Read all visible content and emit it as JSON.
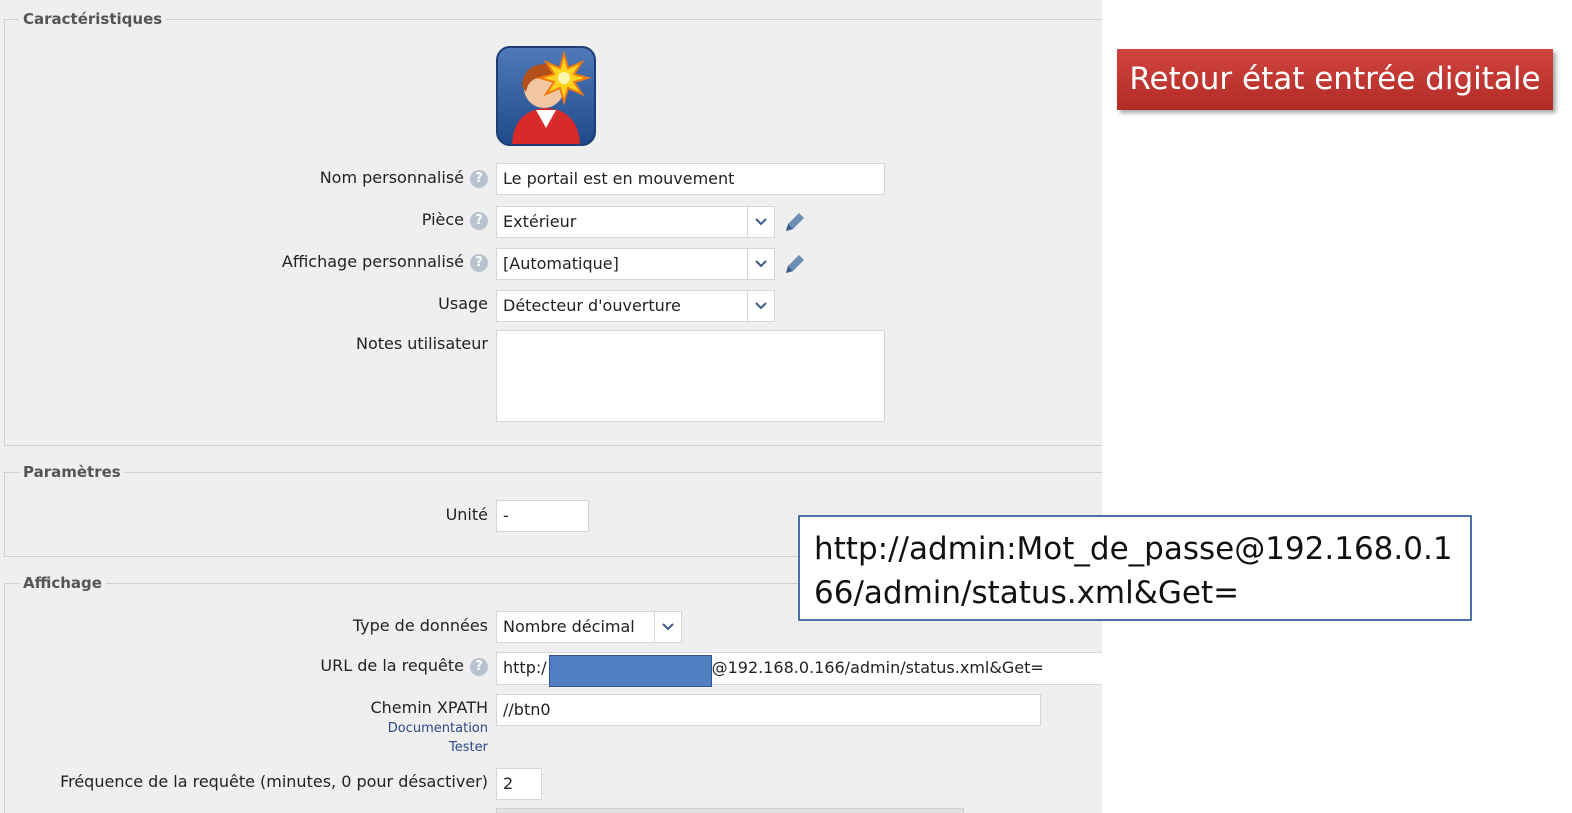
{
  "sections": {
    "caracteristiques": "Caractéristiques",
    "parametres": "Paramètres",
    "affichage": "Affichage"
  },
  "caracteristiques": {
    "nom_label": "Nom personnalisé",
    "nom_value": "Le portail est en mouvement",
    "piece_label": "Pièce",
    "piece_value": "Extérieur",
    "affichage_label": "Affichage personnalisé",
    "affichage_value": "[Automatique]",
    "usage_label": "Usage",
    "usage_value": "Détecteur d'ouverture",
    "notes_label": "Notes utilisateur",
    "notes_value": ""
  },
  "parametres": {
    "unite_label": "Unité",
    "unite_value": "-"
  },
  "affichage": {
    "type_label": "Type de données",
    "type_value": "Nombre décimal",
    "url_label": "URL de la requête",
    "url_prefix": "http:/",
    "url_suffix": "@192.168.0.166/admin/status.xml&Get=",
    "xpath_label": "Chemin XPATH",
    "xpath_value": "//btn0",
    "documentation_link": "Documentation",
    "tester_link": "Tester",
    "freq_label": "Fréquence de la requête (minutes, 0 pour désactiver)",
    "freq_value": "2"
  },
  "annotation": {
    "title_badge": "Retour état entrée digitale",
    "callout_text": "http://admin:Mot_de_passe@192.168.0.166/admin/status.xml&Get="
  },
  "icons": {
    "help": "help-icon",
    "chevron": "chevron-down-icon",
    "pencil": "pencil-icon",
    "avatar": "user-alert-avatar-icon"
  },
  "colors": {
    "badge_red": "#c0342f",
    "callout_border": "#4a72a8",
    "redaction_blue": "#4f7fc1"
  }
}
